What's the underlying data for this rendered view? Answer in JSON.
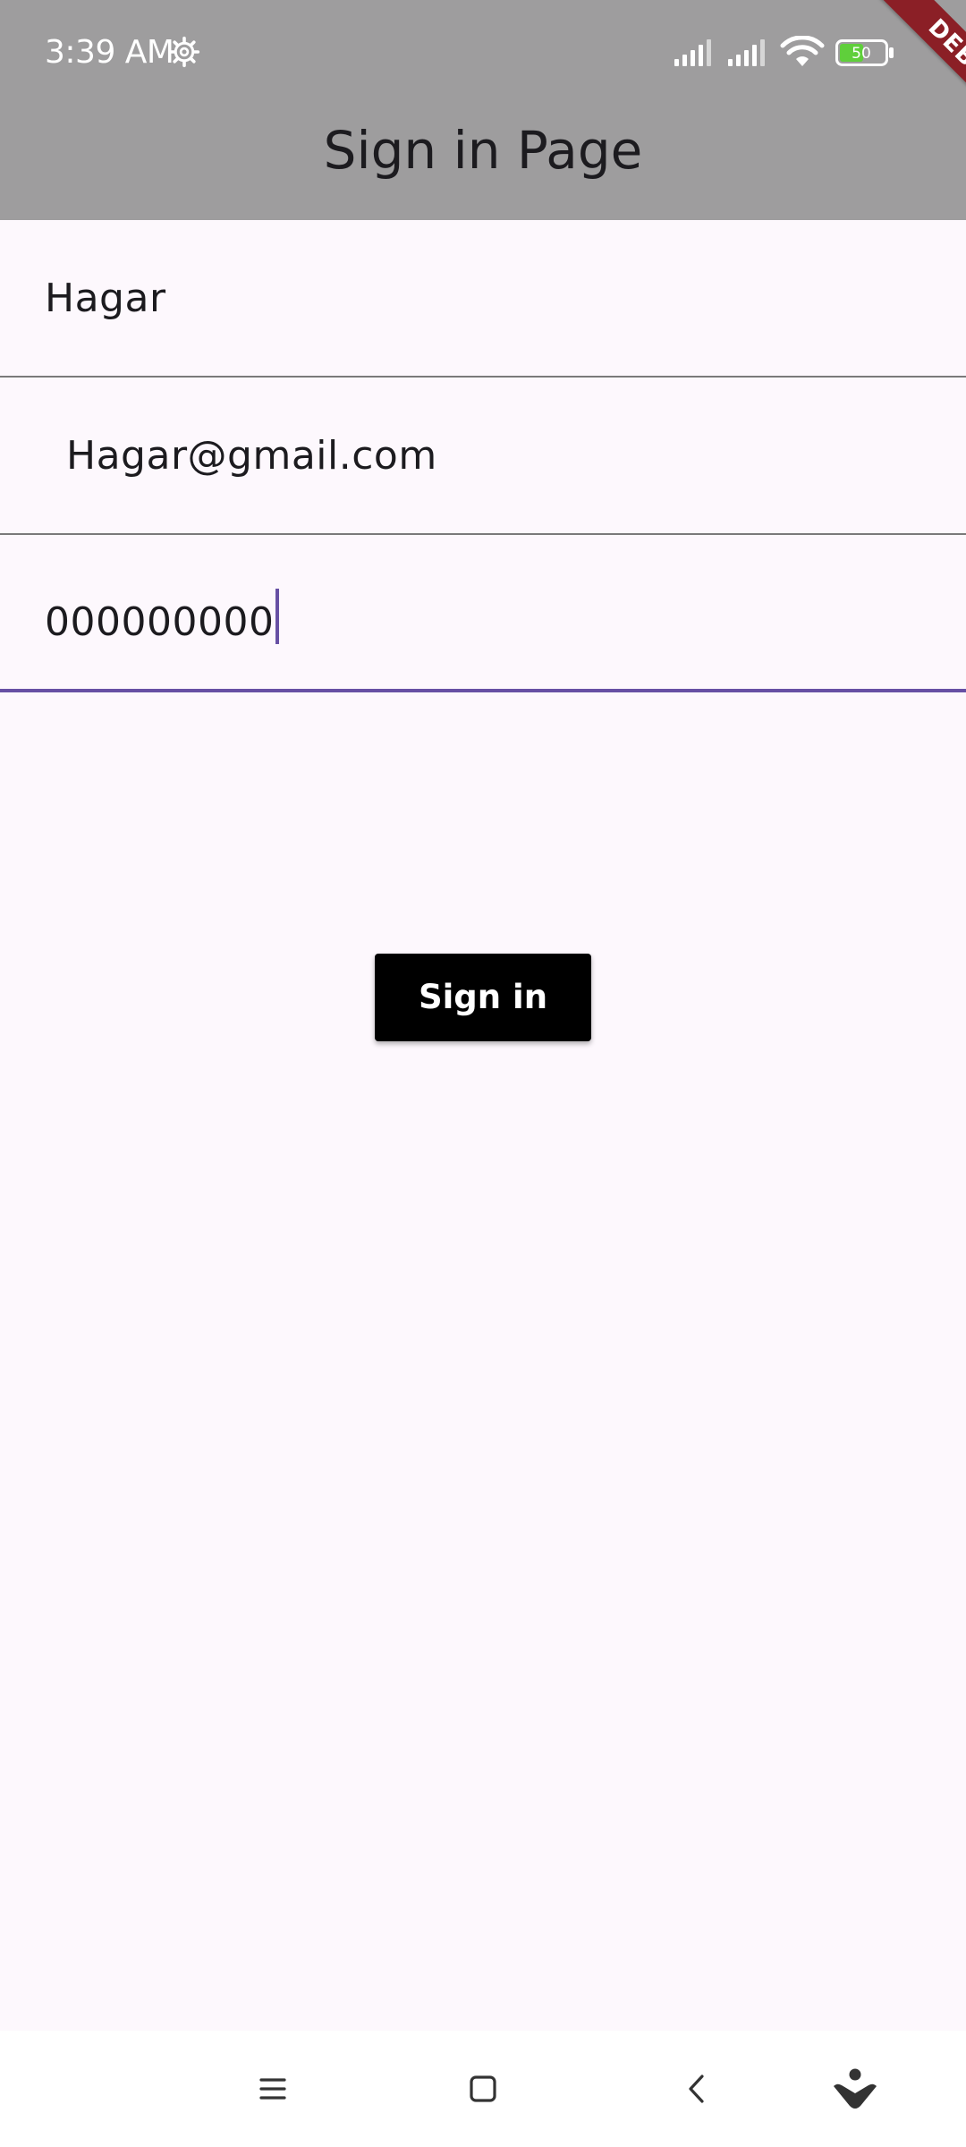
{
  "status_bar": {
    "time": "3:39 AM",
    "battery_level": "50",
    "icons": [
      "settings-gear-icon",
      "signal-icon",
      "signal-icon",
      "wifi-icon",
      "battery-icon"
    ]
  },
  "debug_banner": "DEBUG",
  "app_bar": {
    "title": "Sign in Page",
    "background": "#9e9d9e"
  },
  "form": {
    "name_value": "Hagar",
    "email_value": "Hagar@gmail.com",
    "password_value": "000000000",
    "focused_field": "password",
    "focus_color": "#6750a4"
  },
  "signin_button": {
    "label": "Sign in",
    "background": "#000000"
  },
  "nav_bar": {
    "icons": [
      "menu-icon",
      "home-icon",
      "back-icon",
      "assistant-icon"
    ]
  }
}
